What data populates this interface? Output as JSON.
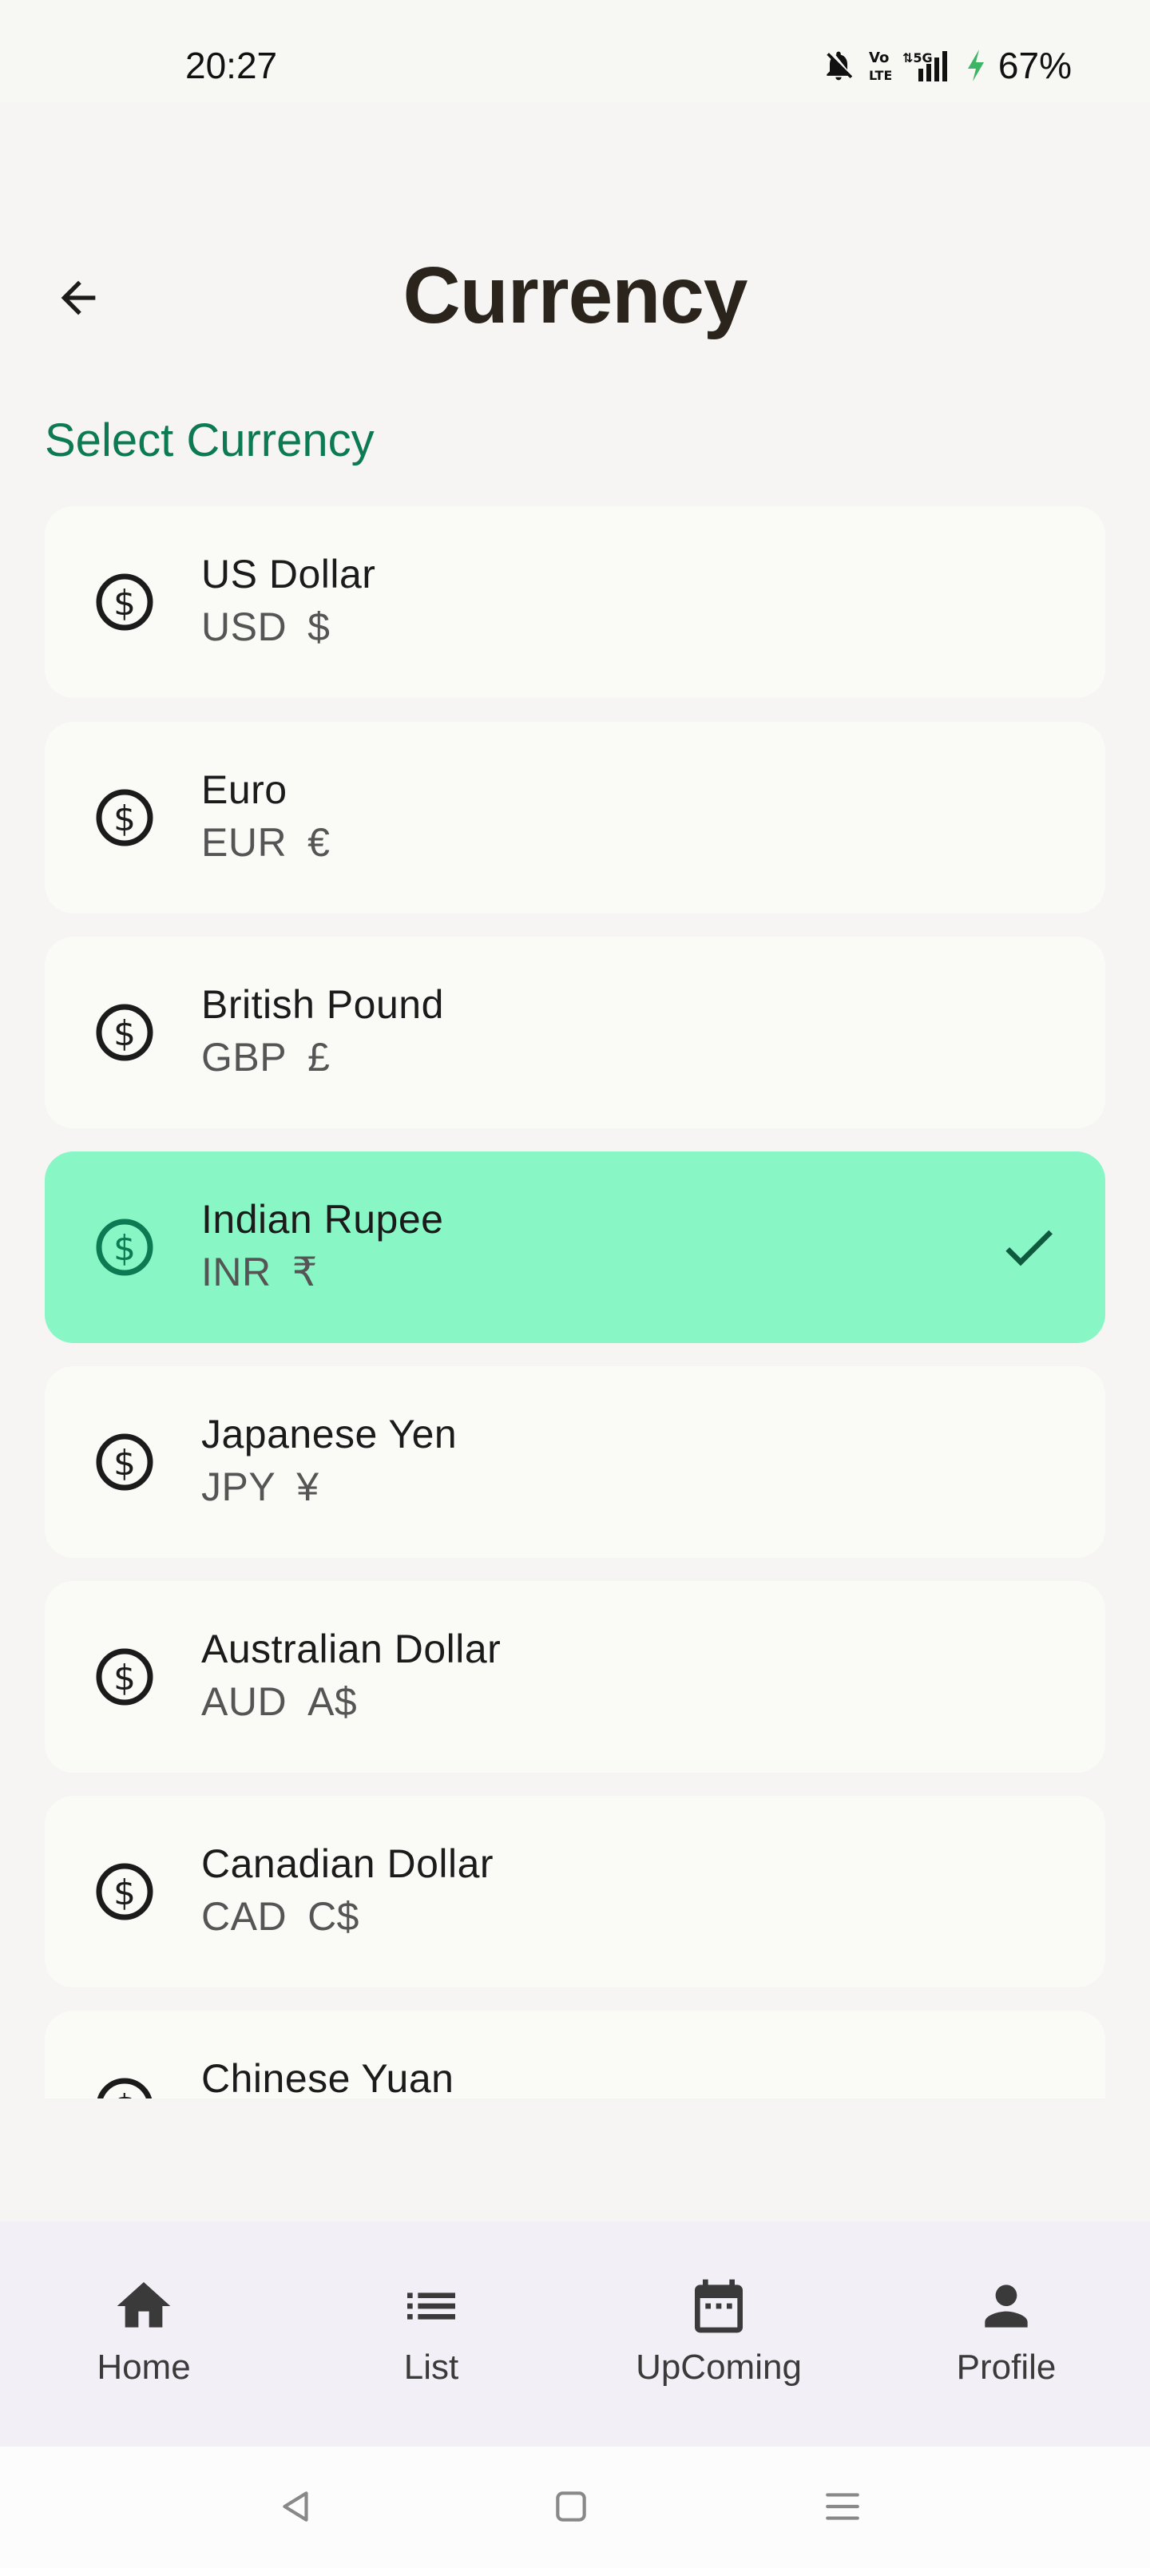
{
  "status_bar": {
    "time": "20:27",
    "battery": "67%",
    "icons": [
      "bell-off-icon",
      "volte-icon",
      "signal-5g-icon",
      "charging-icon"
    ]
  },
  "header": {
    "title": "Currency",
    "back_icon": "arrow-back-icon"
  },
  "section_label": "Select Currency",
  "currencies": [
    {
      "name": "US Dollar",
      "code": "USD",
      "symbol": "$",
      "selected": false
    },
    {
      "name": "Euro",
      "code": "EUR",
      "symbol": "€",
      "selected": false
    },
    {
      "name": "British Pound",
      "code": "GBP",
      "symbol": "£",
      "selected": false
    },
    {
      "name": "Indian Rupee",
      "code": "INR",
      "symbol": "₹",
      "selected": true
    },
    {
      "name": "Japanese Yen",
      "code": "JPY",
      "symbol": "¥",
      "selected": false
    },
    {
      "name": "Australian Dollar",
      "code": "AUD",
      "symbol": "A$",
      "selected": false
    },
    {
      "name": "Canadian Dollar",
      "code": "CAD",
      "symbol": "C$",
      "selected": false
    },
    {
      "name": "Chinese Yuan",
      "code": "",
      "symbol": "",
      "selected": false
    }
  ],
  "bottom_nav": [
    {
      "label": "Home",
      "icon": "home-icon"
    },
    {
      "label": "List",
      "icon": "list-icon"
    },
    {
      "label": "UpComing",
      "icon": "calendar-icon"
    },
    {
      "label": "Profile",
      "icon": "person-icon"
    }
  ],
  "colors": {
    "accent": "#0c7a52",
    "selected_bg": "#88f7c5",
    "card_bg": "#fafbf7",
    "page_bg": "#f6f5f3",
    "nav_bg": "#f2eff7"
  }
}
